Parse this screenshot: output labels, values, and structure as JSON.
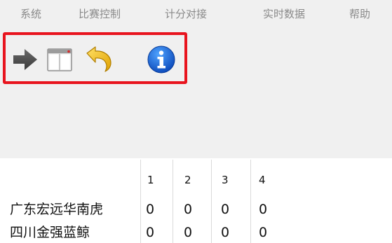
{
  "menu": [
    {
      "label": "系统"
    },
    {
      "label": "比赛控制"
    },
    {
      "label": "计分对接"
    },
    {
      "label": "实时数据"
    },
    {
      "label": "帮助"
    }
  ],
  "toolbar": {
    "buttons": [
      {
        "name": "forward-arrow-icon"
      },
      {
        "name": "window-layout-icon"
      },
      {
        "name": "undo-icon"
      },
      {
        "name": "info-icon"
      }
    ],
    "highlight_color": "#e8141e"
  },
  "scoreboard": {
    "columns": [
      "1",
      "2",
      "3",
      "4"
    ],
    "rows": [
      {
        "team": "广东宏远华南虎",
        "scores": [
          "0",
          "0",
          "0",
          "0"
        ]
      },
      {
        "team": "四川金强蓝鲸",
        "scores": [
          "0",
          "0",
          "0",
          "0"
        ]
      }
    ]
  }
}
